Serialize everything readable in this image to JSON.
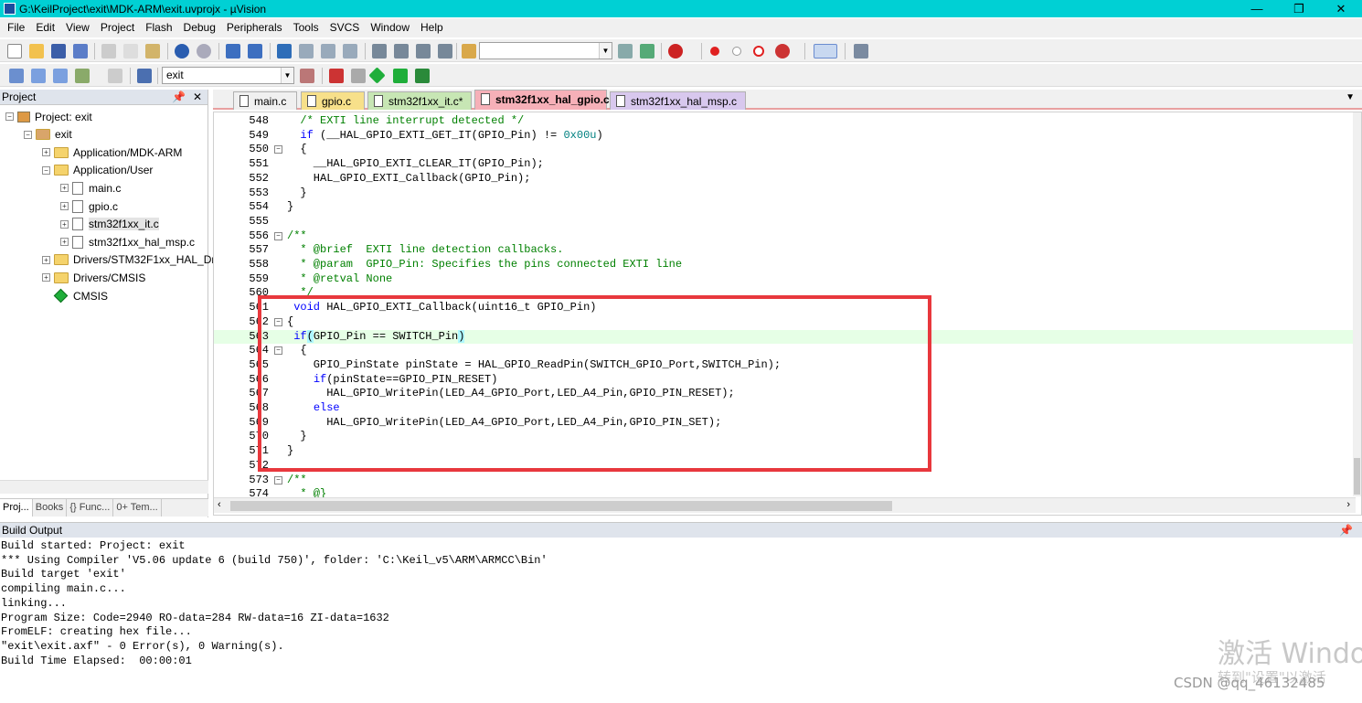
{
  "window": {
    "title": "G:\\KeilProject\\exit\\MDK-ARM\\exit.uvprojx - µVision"
  },
  "menu": [
    "File",
    "Edit",
    "View",
    "Project",
    "Flash",
    "Debug",
    "Peripherals",
    "Tools",
    "SVCS",
    "Window",
    "Help"
  ],
  "toolbar2": {
    "target": "exit"
  },
  "project_panel": {
    "title": "Project",
    "tree": [
      {
        "label": "Project: exit",
        "level": 0,
        "type": "project"
      },
      {
        "label": "exit",
        "level": 1,
        "type": "target"
      },
      {
        "label": "Application/MDK-ARM",
        "level": 2,
        "type": "folder"
      },
      {
        "label": "Application/User",
        "level": 2,
        "type": "folder"
      },
      {
        "label": "main.c",
        "level": 3,
        "type": "file"
      },
      {
        "label": "gpio.c",
        "level": 3,
        "type": "file"
      },
      {
        "label": "stm32f1xx_it.c",
        "level": 3,
        "type": "file"
      },
      {
        "label": "stm32f1xx_hal_msp.c",
        "level": 3,
        "type": "file"
      },
      {
        "label": "Drivers/STM32F1xx_HAL_Dr",
        "level": 2,
        "type": "folder"
      },
      {
        "label": "Drivers/CMSIS",
        "level": 2,
        "type": "folder"
      },
      {
        "label": "CMSIS",
        "level": 2,
        "type": "component"
      }
    ],
    "tabs": [
      "Proj...",
      "Books",
      "{} Func...",
      "0+ Tem..."
    ]
  },
  "editor_tabs": [
    {
      "label": "main.c",
      "color": "#f0f0f0"
    },
    {
      "label": "gpio.c",
      "color": "#f7e08a"
    },
    {
      "label": "stm32f1xx_it.c*",
      "color": "#c7e6b4"
    },
    {
      "label": "stm32f1xx_hal_gpio.c",
      "color": "#f6b0b8",
      "active": true
    },
    {
      "label": "stm32f1xx_hal_msp.c",
      "color": "#d8c8ee"
    }
  ],
  "code_lines": [
    {
      "n": "548",
      "fold": "",
      "html": "  <span class='cm'>/* EXTI line interrupt detected */</span>"
    },
    {
      "n": "549",
      "fold": "",
      "html": "  <span class='kw'>if</span> (__HAL_GPIO_EXTI_GET_IT(GPIO_Pin) != <span class='nm'>0x00u</span>)"
    },
    {
      "n": "550",
      "fold": "-",
      "html": "  {"
    },
    {
      "n": "551",
      "fold": "",
      "html": "    __HAL_GPIO_EXTI_CLEAR_IT(GPIO_Pin);"
    },
    {
      "n": "552",
      "fold": "",
      "html": "    HAL_GPIO_EXTI_Callback(GPIO_Pin);"
    },
    {
      "n": "553",
      "fold": "",
      "html": "  }"
    },
    {
      "n": "554",
      "fold": "",
      "html": "}"
    },
    {
      "n": "555",
      "fold": "",
      "html": ""
    },
    {
      "n": "556",
      "fold": "-",
      "html": "<span class='cm'>/**</span>"
    },
    {
      "n": "557",
      "fold": "",
      "html": "<span class='cm'>  * @brief  EXTI line detection callbacks.</span>"
    },
    {
      "n": "558",
      "fold": "",
      "html": "<span class='cm'>  * @param  GPIO_Pin: Specifies the pins connected EXTI line</span>"
    },
    {
      "n": "559",
      "fold": "",
      "html": "<span class='cm'>  * @retval None</span>"
    },
    {
      "n": "560",
      "fold": "",
      "html": "<span class='cm'>  */</span>"
    },
    {
      "n": "561",
      "fold": "",
      "html": " <span class='kw'>void</span> HAL_GPIO_EXTI_Callback(uint16_t GPIO_Pin)"
    },
    {
      "n": "562",
      "fold": "-",
      "html": "{"
    },
    {
      "n": "563",
      "fold": "",
      "hl": true,
      "html": " <span class='kw'>if</span><span class='brk'>(</span>GPIO_Pin == SWITCH_Pin<span class='brk'>)</span>"
    },
    {
      "n": "564",
      "fold": "-",
      "html": "  {"
    },
    {
      "n": "565",
      "fold": "",
      "html": "    GPIO_PinState pinState = HAL_GPIO_ReadPin(SWITCH_GPIO_Port,SWITCH_Pin);"
    },
    {
      "n": "566",
      "fold": "",
      "html": "    <span class='kw'>if</span>(pinState==GPIO_PIN_RESET)"
    },
    {
      "n": "567",
      "fold": "",
      "html": "      HAL_GPIO_WritePin(LED_A4_GPIO_Port,LED_A4_Pin,GPIO_PIN_RESET);"
    },
    {
      "n": "568",
      "fold": "",
      "html": "    <span class='kw'>else</span>"
    },
    {
      "n": "569",
      "fold": "",
      "html": "      HAL_GPIO_WritePin(LED_A4_GPIO_Port,LED_A4_Pin,GPIO_PIN_SET);"
    },
    {
      "n": "570",
      "fold": "",
      "html": "  }"
    },
    {
      "n": "571",
      "fold": "",
      "html": "}"
    },
    {
      "n": "572",
      "fold": "",
      "html": ""
    },
    {
      "n": "573",
      "fold": "-",
      "html": "<span class='cm'>/**</span>"
    },
    {
      "n": "574",
      "fold": "",
      "html": "<span class='cm'>  * @}</span>"
    }
  ],
  "build_output": {
    "title": "Build Output",
    "lines": [
      "Build started: Project: exit",
      "*** Using Compiler 'V5.06 update 6 (build 750)', folder: 'C:\\Keil_v5\\ARM\\ARMCC\\Bin'",
      "Build target 'exit'",
      "compiling main.c...",
      "linking...",
      "Program Size: Code=2940 RO-data=284 RW-data=16 ZI-data=1632",
      "FromELF: creating hex file...",
      "\"exit\\exit.axf\" - 0 Error(s), 0 Warning(s).",
      "Build Time Elapsed:  00:00:01"
    ]
  },
  "watermark": {
    "line1": "激活 Windo",
    "line2": "转到\"设置\"以激活",
    "csdn": "CSDN @qq_46132485"
  }
}
